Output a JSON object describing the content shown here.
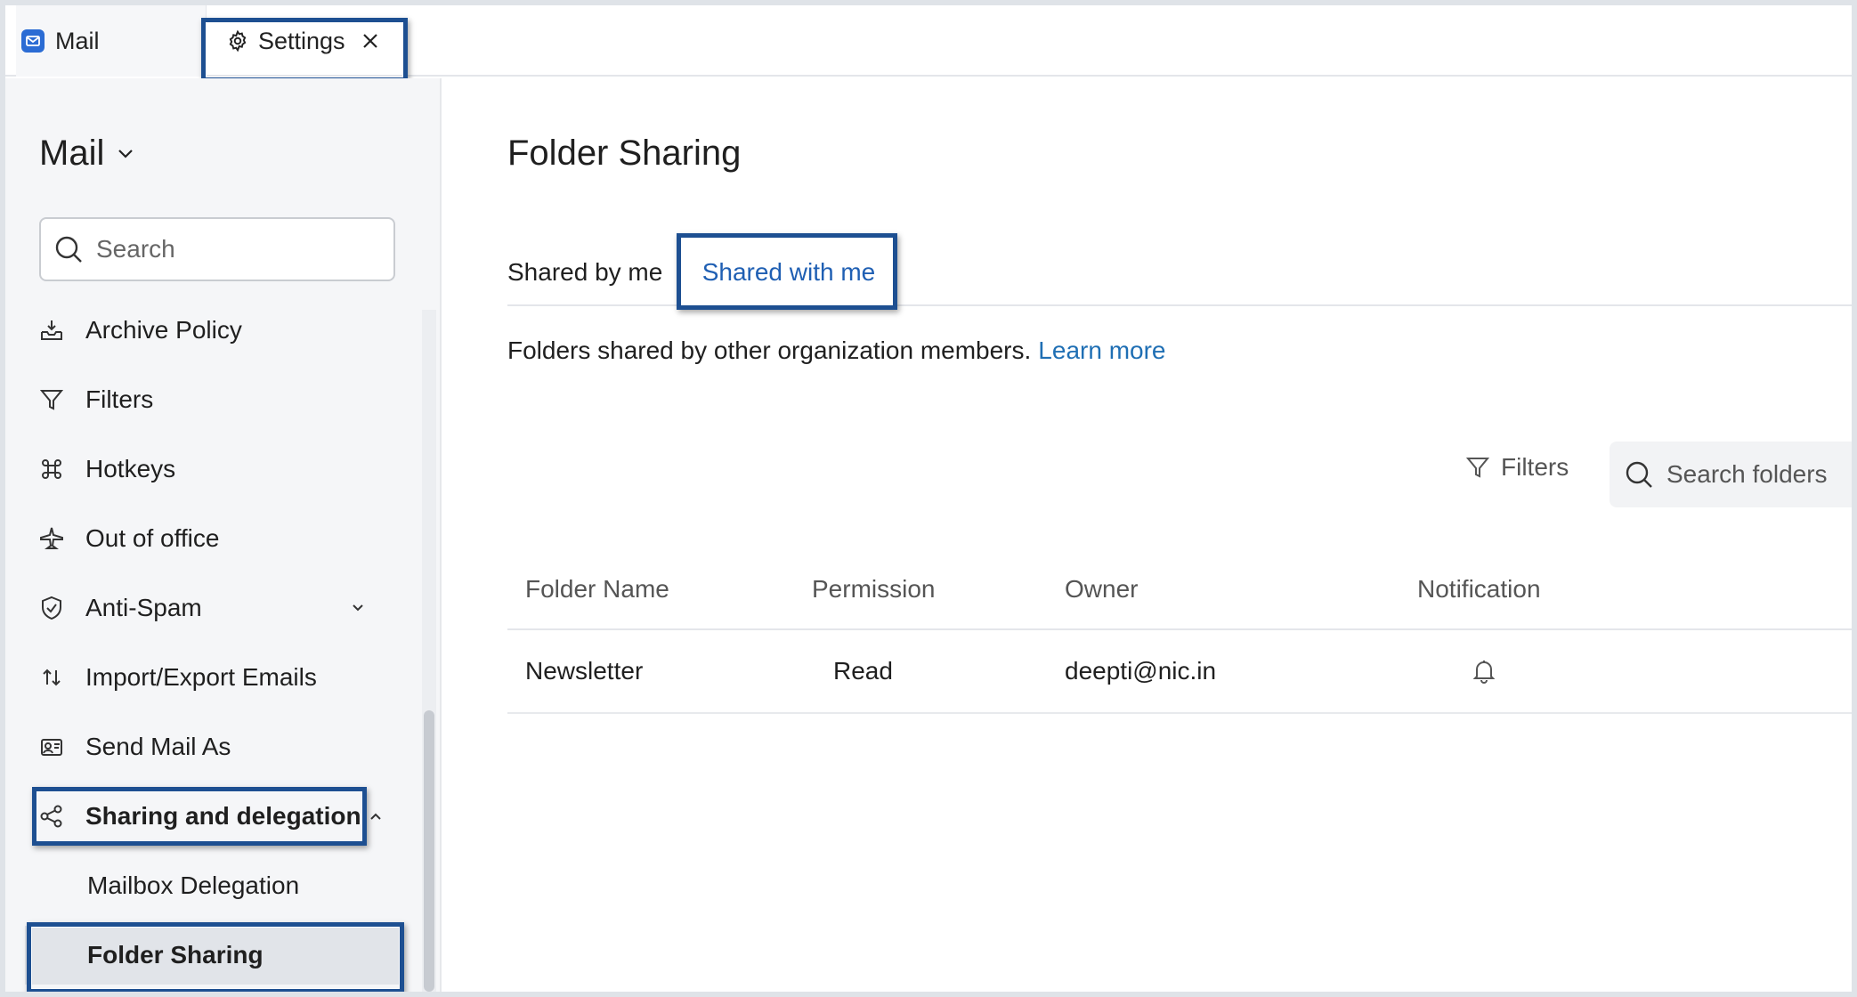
{
  "tabs": {
    "mail_label": "Mail",
    "settings_label": "Settings"
  },
  "sidebar": {
    "title": "Mail",
    "search_placeholder": "Search",
    "items": [
      {
        "label": "Archive Policy",
        "icon": "archive-tray-icon"
      },
      {
        "label": "Filters",
        "icon": "funnel-icon"
      },
      {
        "label": "Hotkeys",
        "icon": "command-key-icon"
      },
      {
        "label": "Out of office",
        "icon": "airplane-icon"
      },
      {
        "label": "Anti-Spam",
        "icon": "shield-check-icon"
      },
      {
        "label": "Import/Export Emails",
        "icon": "import-export-arrows-icon"
      },
      {
        "label": "Send Mail As",
        "icon": "id-card-icon"
      },
      {
        "label": "Sharing and delegation",
        "icon": "share-icon"
      }
    ],
    "sub_items": [
      {
        "label": "Mailbox Delegation"
      },
      {
        "label": "Folder Sharing"
      }
    ]
  },
  "main": {
    "title": "Folder Sharing",
    "subtabs": {
      "shared_by_me": "Shared by me",
      "shared_with_me": "Shared with me"
    },
    "description": "Folders shared by other organization members.",
    "learn_more": "Learn more",
    "filters_label": "Filters",
    "search_placeholder": "Search folders",
    "table": {
      "headers": [
        "Folder Name",
        "Permission",
        "Owner",
        "Notification"
      ],
      "rows": [
        {
          "folder": "Newsletter",
          "permission": "Read",
          "owner": "deepti@nic.in",
          "notification_icon": "bell-icon"
        }
      ]
    }
  },
  "colors": {
    "highlight_border": "#1d4f91",
    "link": "#1f6fb4",
    "active_tab_text": "#1f5fb3",
    "mail_icon": "#2b6cd4"
  }
}
